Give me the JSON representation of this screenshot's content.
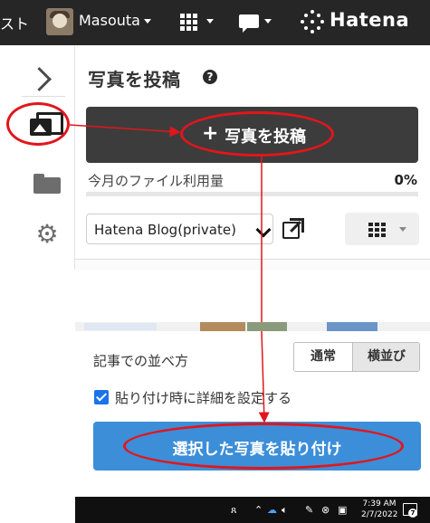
{
  "topbar": {
    "left_text": "スト",
    "username": "Masouta",
    "brand": "Hatena"
  },
  "sidebar": {
    "items": [
      {
        "label": "expand",
        "icon": "chevron-right-icon"
      },
      {
        "label": "photos",
        "icon": "photo-icon"
      },
      {
        "label": "folders",
        "icon": "folder-icon"
      },
      {
        "label": "settings",
        "icon": "gear-icon"
      }
    ]
  },
  "panel": {
    "title": "写真を投稿",
    "help_icon": "?",
    "upload_button": {
      "plus": "+",
      "label": "写真を投稿"
    },
    "usage": {
      "label": "今月のファイル利用量",
      "value": "0%",
      "fraction": 0
    },
    "blog_select": {
      "value": "Hatena Blog(private)"
    }
  },
  "settings": {
    "sort_label": "記事での並べ方",
    "sort_options": [
      "通常",
      "横並び"
    ],
    "sort_selected": "横並び",
    "detail_checkbox": {
      "label": "貼り付け時に詳細を設定する",
      "checked": true
    },
    "paste_button": {
      "label": "選択した写真を貼り付け"
    }
  },
  "taskbar": {
    "time": "7:39 AM",
    "date": "2/7/2022",
    "notifications": "7",
    "tray_icons": [
      "person-icon",
      "chevron-up-icon",
      "onedrive-icon",
      "speaker-icon",
      "pen-icon",
      "close-circle-icon",
      "camera-icon"
    ]
  },
  "colors": {
    "topbar_bg": "#262626",
    "upload_button_bg": "#3c3c3c",
    "paste_button_bg": "#3c8ed8",
    "annotation_red": "#e1161c",
    "checkbox_blue": "#1a73e8"
  }
}
